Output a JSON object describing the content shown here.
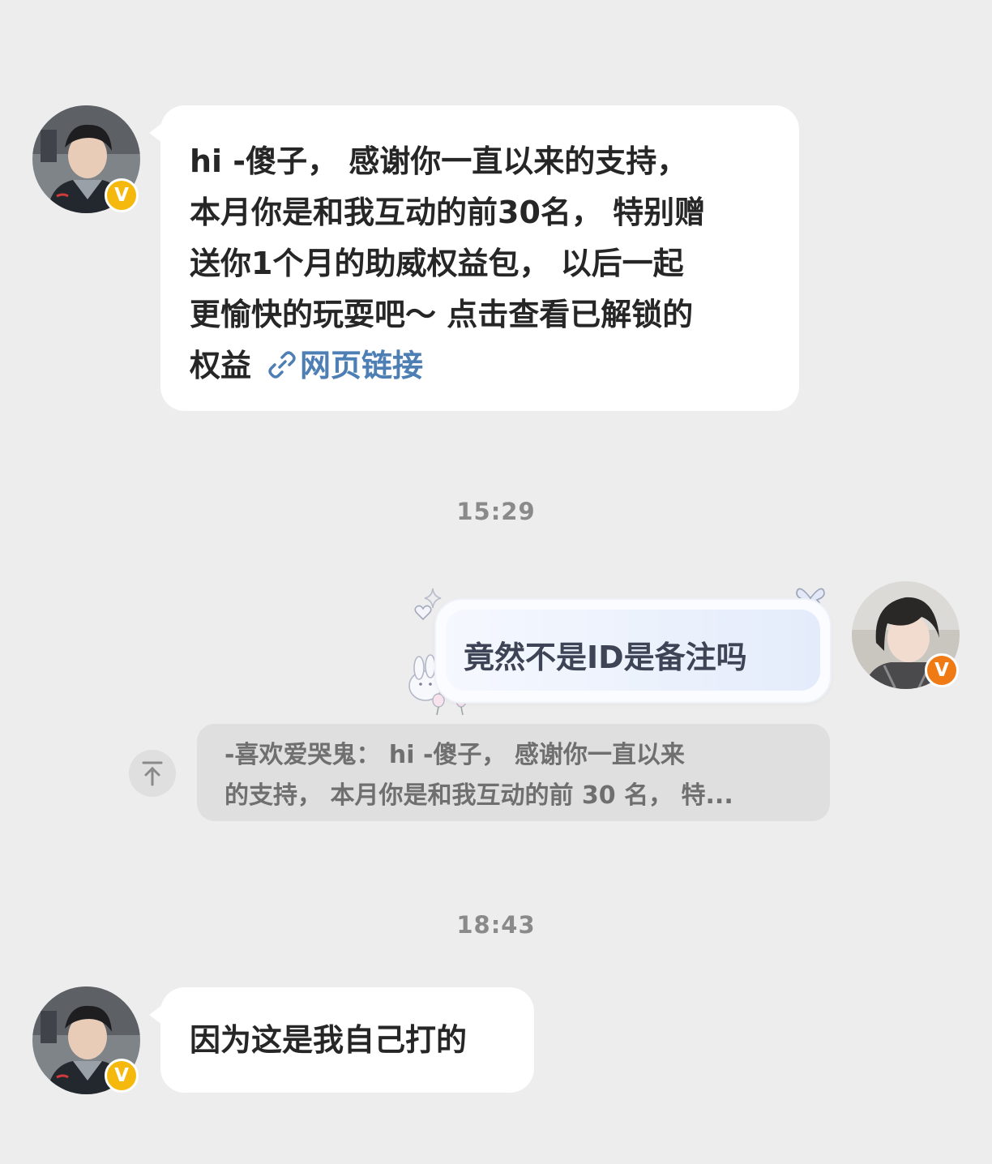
{
  "messages": [
    {
      "sender": "other",
      "lines": [
        "hi -傻子， 感谢你一直以来的支持，",
        "本月你是和我互动的前30名， 特别赠",
        "送你1个月的助威权益包， 以后一起",
        "更愉快的玩耍吧～ 点击查看已解锁的"
      ],
      "last_line_prefix": "权益",
      "link_label": "网页链接",
      "link_icon": "link-icon",
      "avatar_badge": "V"
    },
    {
      "sender": "me",
      "text": "竟然不是ID是备注吗",
      "avatar_badge": "V",
      "quote": {
        "line1": "-喜欢爱哭鬼： hi -傻子， 感谢你一直以来",
        "line2": "的支持， 本月你是和我互动的前 30 名， 特..."
      }
    },
    {
      "sender": "other",
      "text": "因为这是我自己打的",
      "avatar_badge": "V"
    }
  ],
  "timestamps": [
    "15:29",
    "18:43"
  ],
  "colors": {
    "background": "#ededed",
    "bubble": "#ffffff",
    "link": "#4d7fb5",
    "badge_yellow": "#f5b90e",
    "badge_orange": "#f07a14",
    "quote_bg": "#dfdfdf"
  }
}
